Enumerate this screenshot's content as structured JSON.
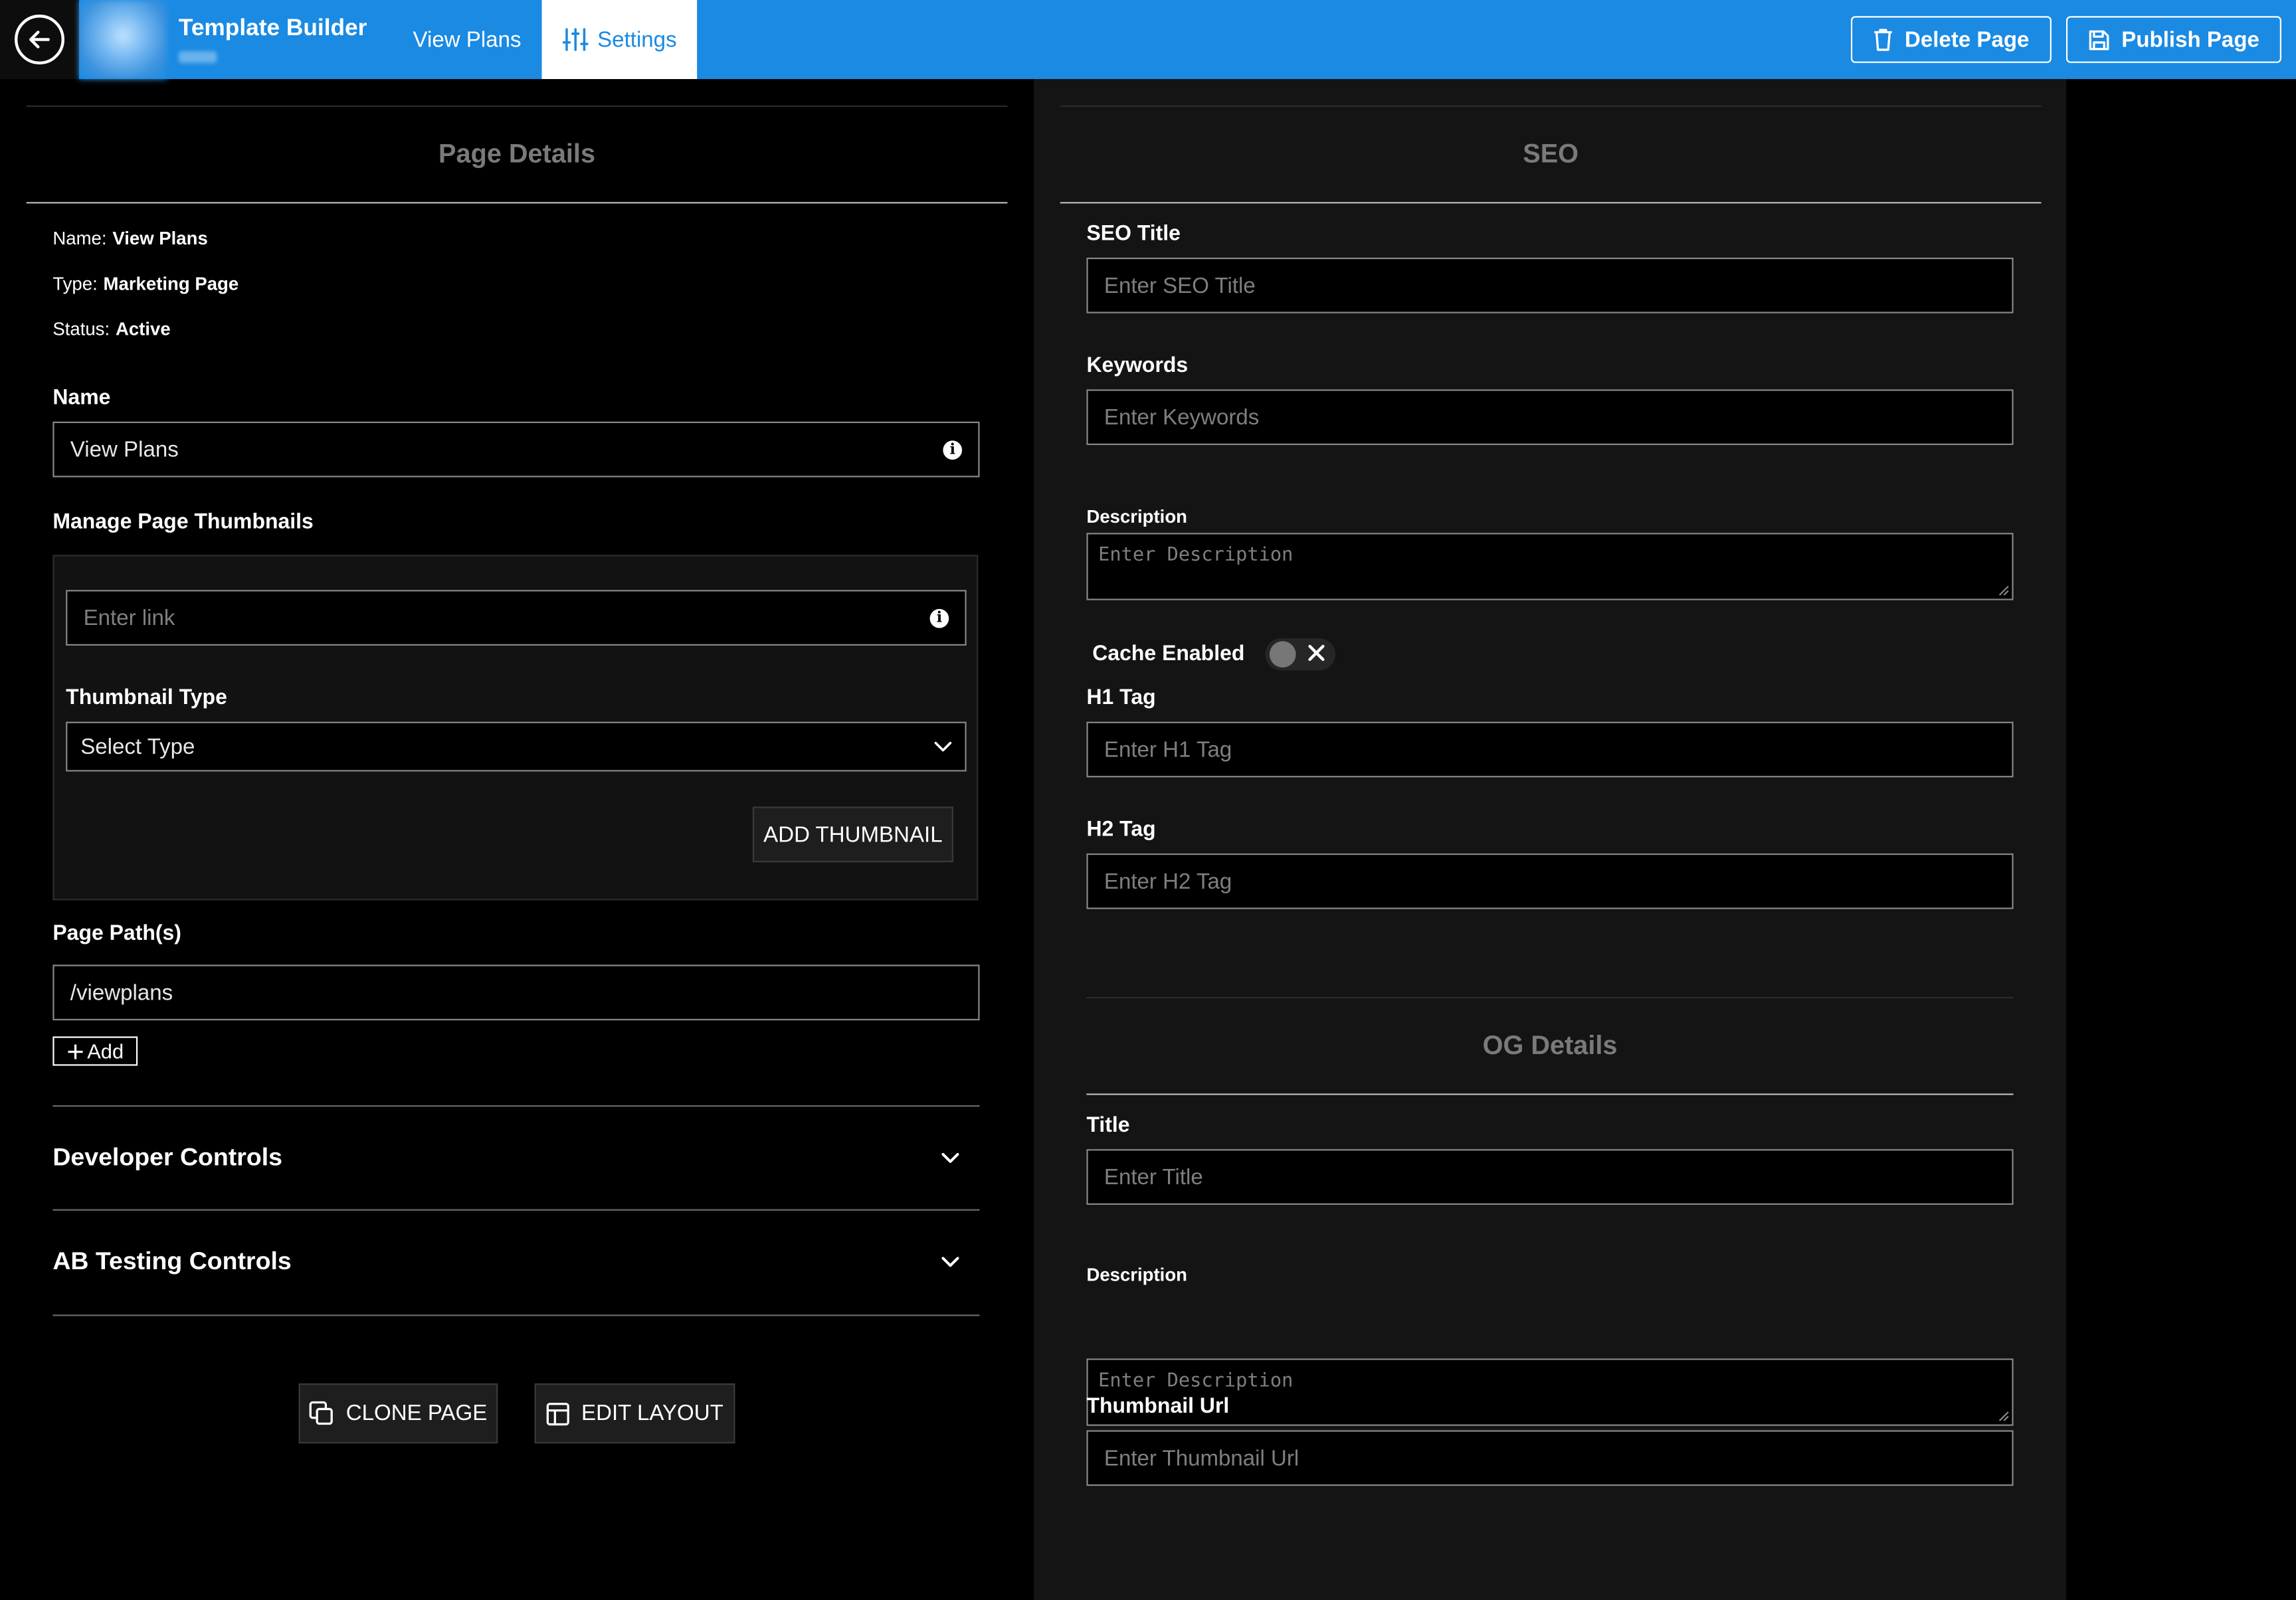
{
  "topbar": {
    "brand_title": "Template Builder",
    "tabs": [
      {
        "label": "View Plans",
        "active": false
      },
      {
        "label": "Settings",
        "active": true,
        "icon": "sliders-icon"
      }
    ],
    "delete_label": "Delete Page",
    "publish_label": "Publish Page",
    "accent_color": "#1a8ae3"
  },
  "page_details": {
    "title": "Page Details",
    "meta": [
      {
        "key": "Name:",
        "value": "View Plans"
      },
      {
        "key": "Type:",
        "value": "Marketing Page"
      },
      {
        "key": "Status:",
        "value": "Active"
      }
    ],
    "name_label": "Name",
    "name_value": "View Plans",
    "thumbnails_label": "Manage Page Thumbnails",
    "link_placeholder": "Enter link",
    "thumbnail_type_label": "Thumbnail Type",
    "thumbnail_type_value": "Select Type",
    "add_thumbnail_label": "ADD THUMBNAIL",
    "paths_label": "Page Path(s)",
    "path_value": "/viewplans",
    "add_label": "Add",
    "developer_controls": "Developer Controls",
    "ab_testing_controls": "AB Testing Controls",
    "clone_label": "CLONE PAGE",
    "edit_layout_label": "EDIT LAYOUT"
  },
  "seo": {
    "title": "SEO",
    "seo_title_label": "SEO Title",
    "seo_title_placeholder": "Enter SEO Title",
    "keywords_label": "Keywords",
    "keywords_placeholder": "Enter Keywords",
    "description_label": "Description",
    "description_placeholder": "Enter Description",
    "cache_label": "Cache Enabled",
    "cache_enabled": false,
    "h1_label": "H1 Tag",
    "h1_placeholder": "Enter H1 Tag",
    "h2_label": "H2 Tag",
    "h2_placeholder": "Enter H2 Tag"
  },
  "og": {
    "title": "OG Details",
    "title_label": "Title",
    "title_placeholder": "Enter Title",
    "description_label": "Description",
    "description_placeholder": "Enter Description",
    "thumbnail_label": "Thumbnail Url",
    "thumbnail_placeholder": "Enter Thumbnail Url"
  }
}
